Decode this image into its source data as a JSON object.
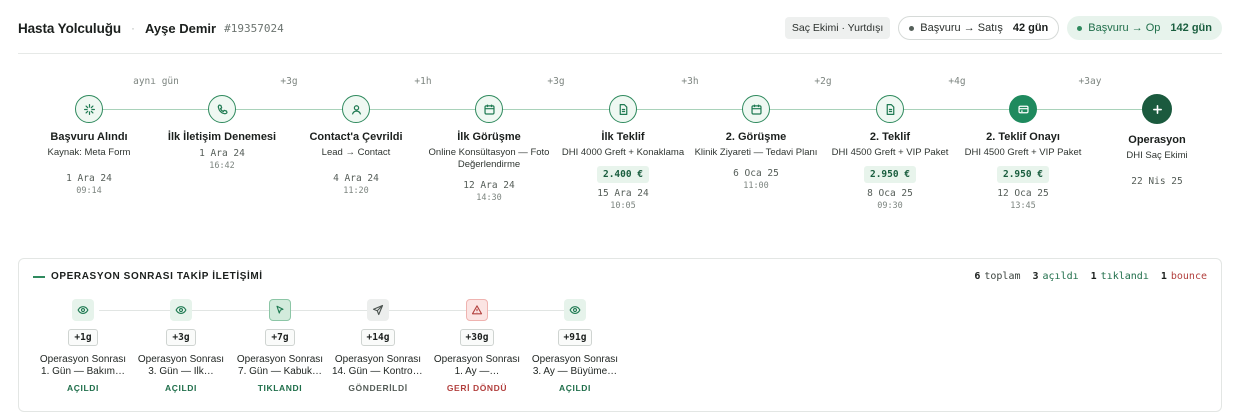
{
  "header": {
    "title": "Hasta Yolculuğu",
    "separator": "·",
    "patient_name": "Ayşe Demir",
    "patient_id": "#19357024",
    "tag": "Saç Ekimi · Yurtdışı",
    "metric1": {
      "label": "Başvuru → Satış",
      "value": "42 gün"
    },
    "metric2": {
      "label": "Başvuru → Op",
      "value": "142 gün"
    }
  },
  "timeline": {
    "gaps": [
      "aynı gün",
      "+3g",
      "+1h",
      "+3g",
      "+3h",
      "+2g",
      "+4g",
      "+3ay"
    ],
    "steps": [
      {
        "title": "Başvuru Alındı",
        "sub": "Kaynak: Meta Form",
        "date": "1 Ara 24",
        "time": "09:14",
        "icon": "sparkle-icon"
      },
      {
        "title": "İlk İletişim Denemesi",
        "sub": "",
        "date": "1 Ara 24",
        "time": "16:42",
        "icon": "phone-icon"
      },
      {
        "title": "Contact'a Çevrildi",
        "sub": "Lead → Contact",
        "date": "4 Ara 24",
        "time": "11:20",
        "icon": "user-icon"
      },
      {
        "title": "İlk Görüşme",
        "sub": "Online Konsültasyon — Foto Değerlendirme",
        "date": "12 Ara 24",
        "time": "14:30",
        "icon": "calendar-icon"
      },
      {
        "title": "İlk Teklif",
        "sub": "DHI 4000 Greft + Konaklama",
        "price": "2.400 €",
        "date": "15 Ara 24",
        "time": "10:05",
        "icon": "document-icon"
      },
      {
        "title": "2. Görüşme",
        "sub": "Klinik Ziyareti — Tedavi Planı",
        "date": "6 Oca 25",
        "time": "11:00",
        "icon": "calendar-icon"
      },
      {
        "title": "2. Teklif",
        "sub": "DHI 4500 Greft + VIP Paket",
        "price": "2.950 €",
        "date": "8 Oca 25",
        "time": "09:30",
        "icon": "document-icon"
      },
      {
        "title": "2. Teklif Onayı",
        "sub": "DHI 4500 Greft + VIP Paket",
        "price": "2.950 €",
        "date": "12 Oca 25",
        "time": "13:45",
        "icon": "card-icon"
      },
      {
        "title": "Operasyon",
        "sub": "DHI Saç Ekimi",
        "date": "22 Nis 25",
        "icon": "plus-icon"
      }
    ]
  },
  "followup": {
    "title": "OPERASYON SONRASI TAKİP İLETİŞİMİ",
    "stats": {
      "total_count": "6",
      "total_label": "toplam",
      "open_count": "3",
      "open_label": "açıldı",
      "click_count": "1",
      "click_label": "tıklandı",
      "bounce_count": "1",
      "bounce_label": "bounce"
    },
    "items": [
      {
        "offset": "+1g",
        "line1": "Operasyon Sonrası",
        "line2": "1. Gün — Bakım…",
        "status": "AÇILDI",
        "icon": "eye-icon"
      },
      {
        "offset": "+3g",
        "line1": "Operasyon Sonrası",
        "line2": "3. Gün — İlk…",
        "status": "AÇILDI",
        "icon": "eye-icon"
      },
      {
        "offset": "+7g",
        "line1": "Operasyon Sonrası",
        "line2": "7. Gün — Kabuk…",
        "status": "TIKLANDI",
        "icon": "cursor-icon"
      },
      {
        "offset": "+14g",
        "line1": "Operasyon Sonrası",
        "line2": "14. Gün — Kontrol…",
        "status": "GÖNDERİLDİ",
        "icon": "send-icon"
      },
      {
        "offset": "+30g",
        "line1": "Operasyon Sonrası",
        "line2": "1. Ay —…",
        "status": "GERİ DÖNDÜ",
        "icon": "warning-icon"
      },
      {
        "offset": "+91g",
        "line1": "Operasyon Sonrası",
        "line2": "3. Ay — Büyüme…",
        "status": "AÇILDI",
        "icon": "eye-icon"
      }
    ]
  }
}
